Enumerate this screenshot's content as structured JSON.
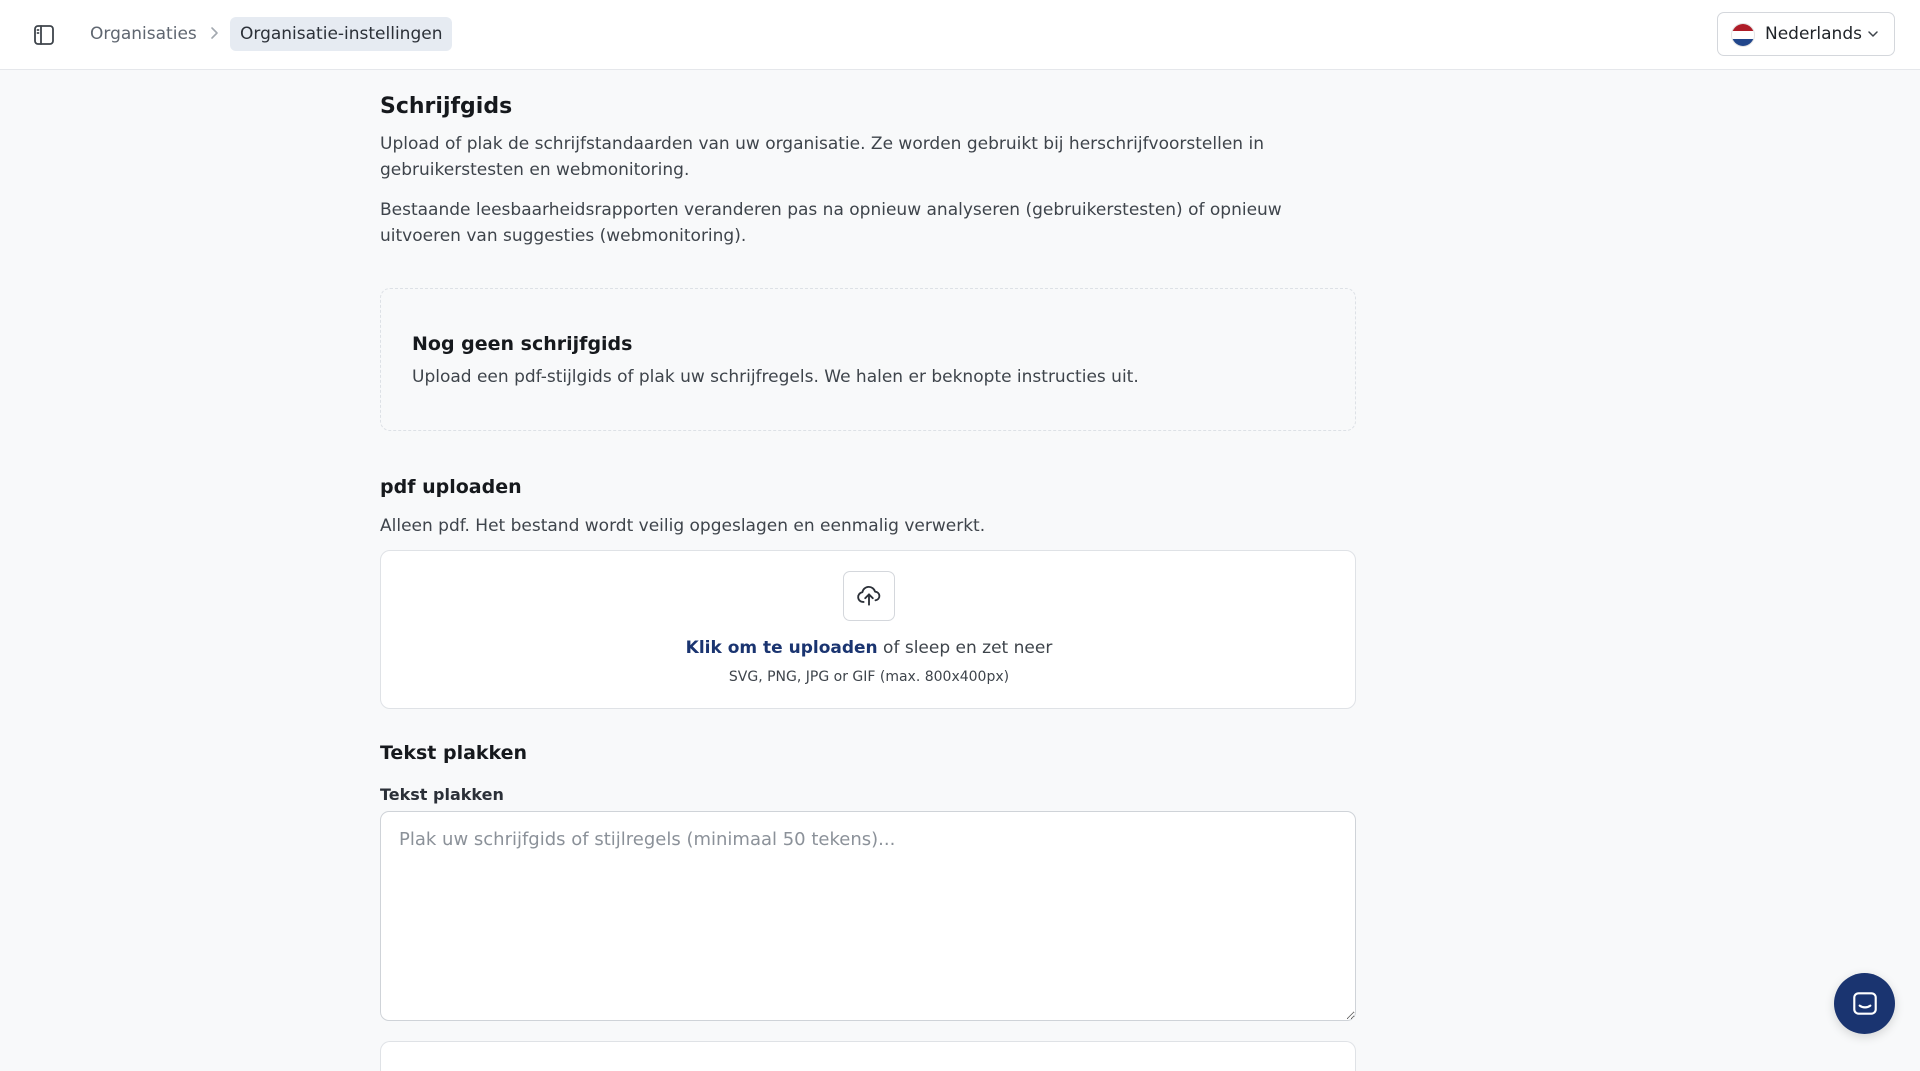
{
  "header": {
    "breadcrumb": [
      "Organisaties",
      "Organisatie-instellingen"
    ],
    "language": {
      "selected": "Nederlands",
      "flag_colors": [
        "#ae1c28",
        "#ffffff",
        "#21468b"
      ]
    },
    "icons": {
      "sidebar_toggle": "sidebar-panel-icon",
      "separator": "chevron-right-icon",
      "dropdown": "chevron-down-icon"
    }
  },
  "guide": {
    "title": "Schrijfgids",
    "description": "Upload of plak de schrijfstandaarden van uw organisatie. Ze worden gebruikt bij herschrijfvoorstellen in gebruikerstesten en webmonitoring.",
    "note": "Bestaande leesbaarheidsrapporten veranderen pas na opnieuw analyseren (gebruikerstesten) of opnieuw uitvoeren van suggesties (webmonitoring)."
  },
  "empty_state": {
    "title": "Nog geen schrijfgids",
    "description": "Upload een pdf-stijlgids of plak uw schrijfregels. We halen er beknopte instructies uit."
  },
  "upload": {
    "title": "pdf uploaden",
    "description": "Alleen pdf. Het bestand wordt veilig opgeslagen en eenmalig verwerkt.",
    "link_text": "Klik om te uploaden",
    "rest_text": " of sleep en zet neer",
    "hint": "SVG, PNG, JPG or GIF (max. 800x400px)",
    "icon": "cloud-upload-icon"
  },
  "paste": {
    "title": "Tekst plakken",
    "field_label": "Tekst plakken",
    "value": "",
    "placeholder": "Plak uw schrijfgids of stijlregels (minimaal 50 tekens)..."
  },
  "chat": {
    "icon": "chat-icon"
  },
  "colors": {
    "accent": "#1a3470",
    "breadcrumb_active_bg": "#e6ebf2",
    "page_bg": "#f8f9fa"
  }
}
